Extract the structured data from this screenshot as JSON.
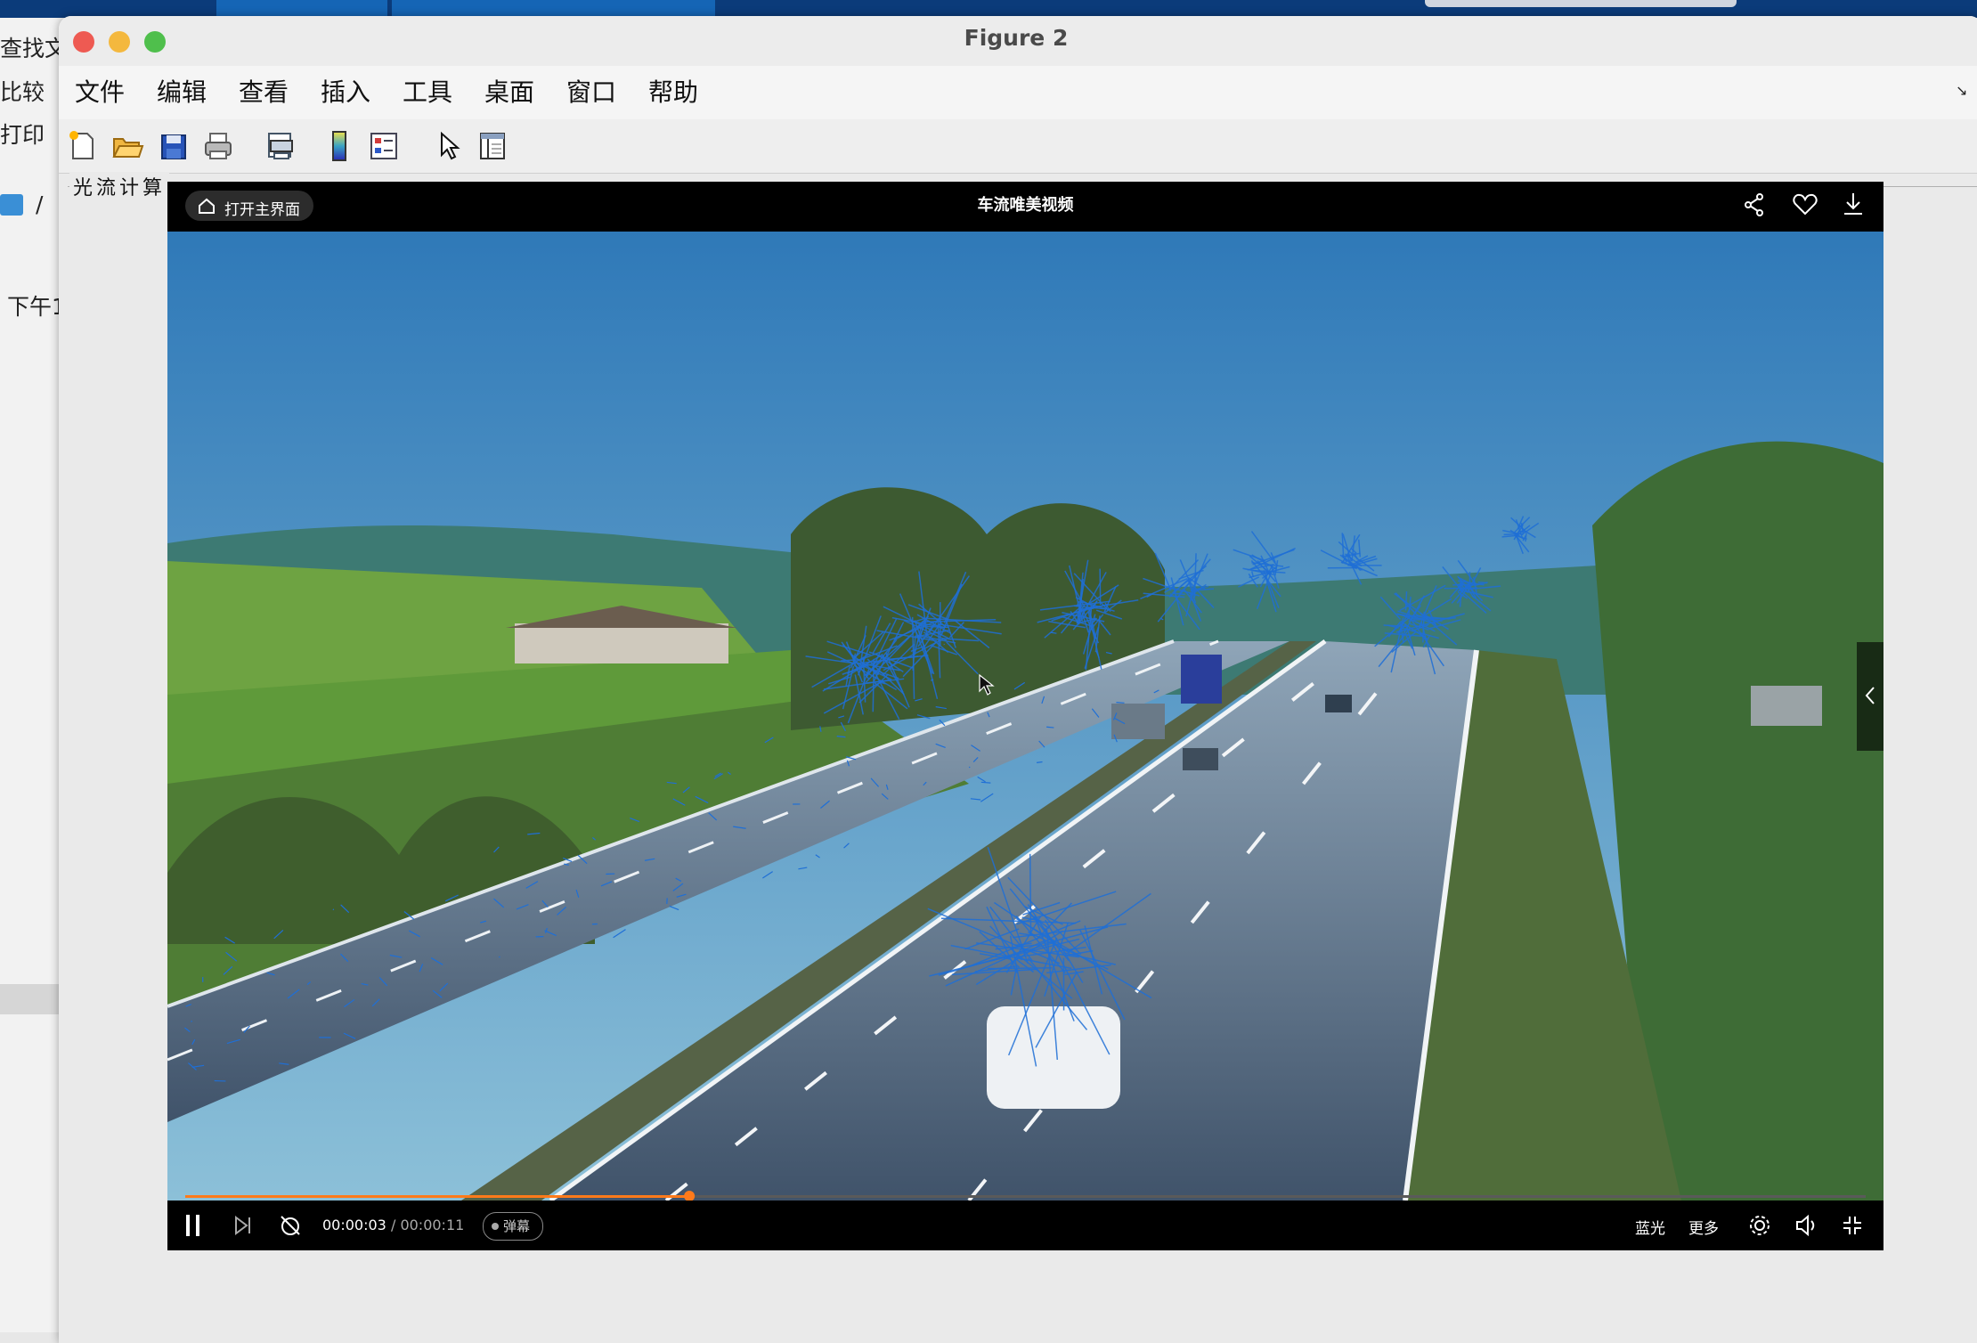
{
  "background": {
    "left_labels": [
      "查找文",
      "比较",
      "打印",
      "/",
      "下午1"
    ]
  },
  "window": {
    "title": "Figure 2",
    "menu": [
      "文件",
      "编辑",
      "查看",
      "插入",
      "工具",
      "桌面",
      "窗口",
      "帮助"
    ],
    "toolbar_icons": [
      "new-figure-icon",
      "open-file-icon",
      "save-icon",
      "print-icon",
      "print-preview-icon",
      "colorbar-icon",
      "legend-icon",
      "pointer-icon",
      "property-inspector-icon"
    ],
    "panel_title": "光流计算"
  },
  "video": {
    "home_button": "打开主界面",
    "title": "车流唯美视频",
    "time_current": "00:00:03",
    "time_separator": "/",
    "time_total": "00:00:11",
    "danmaku": "弹幕",
    "quality": "蓝光",
    "more": "更多",
    "progress_fraction": 0.3,
    "accent_color": "#ff7a1a",
    "flow_color": "#1f6fd6",
    "icons": [
      "home-icon",
      "share-icon",
      "favorite-icon",
      "download-icon",
      "pause-icon",
      "next-icon",
      "loop-off-icon",
      "settings-icon",
      "volume-icon",
      "exit-fullscreen-icon",
      "side-collapse-icon"
    ]
  }
}
